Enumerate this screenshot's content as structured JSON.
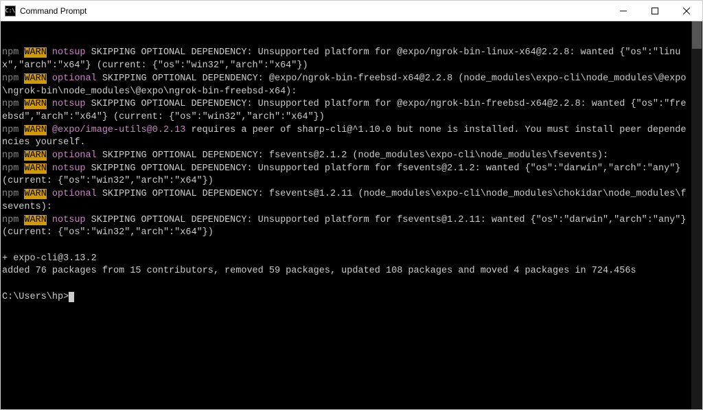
{
  "window": {
    "title": "Command Prompt",
    "icon_label": "C:\\"
  },
  "terminal": {
    "lines": [
      {
        "segments": [
          [
            "npm",
            "npm "
          ],
          [
            "warn",
            "WARN"
          ],
          [
            "plain",
            " "
          ],
          [
            "notsup",
            "notsup"
          ],
          [
            "plain",
            " SKIPPING OPTIONAL DEPENDENCY: Unsupported platform for @expo/ngrok-bin-linux-x64@2.2.8: wanted {\"os\":\"linux\",\"arch\":\"x64\"} (current: {\"os\":\"win32\",\"arch\":\"x64\"})"
          ]
        ]
      },
      {
        "segments": [
          [
            "npm",
            "npm "
          ],
          [
            "warn",
            "WARN"
          ],
          [
            "plain",
            " "
          ],
          [
            "optional",
            "optional"
          ],
          [
            "plain",
            " SKIPPING OPTIONAL DEPENDENCY: @expo/ngrok-bin-freebsd-x64@2.2.8 (node_modules\\expo-cli\\node_modules\\@expo\\ngrok-bin\\node_modules\\@expo\\ngrok-bin-freebsd-x64):"
          ]
        ]
      },
      {
        "segments": [
          [
            "npm",
            "npm "
          ],
          [
            "warn",
            "WARN"
          ],
          [
            "plain",
            " "
          ],
          [
            "notsup",
            "notsup"
          ],
          [
            "plain",
            " SKIPPING OPTIONAL DEPENDENCY: Unsupported platform for @expo/ngrok-bin-freebsd-x64@2.2.8: wanted {\"os\":\"freebsd\",\"arch\":\"x64\"} (current: {\"os\":\"win32\",\"arch\":\"x64\"})"
          ]
        ]
      },
      {
        "segments": [
          [
            "npm",
            "npm "
          ],
          [
            "warn",
            "WARN"
          ],
          [
            "plain",
            " "
          ],
          [
            "pkg",
            "@expo/image-utils@0.2.13"
          ],
          [
            "plain",
            " requires a peer of sharp-cli@^1.10.0 but none is installed. You must install peer dependencies yourself."
          ]
        ]
      },
      {
        "segments": [
          [
            "npm",
            "npm "
          ],
          [
            "warn",
            "WARN"
          ],
          [
            "plain",
            " "
          ],
          [
            "optional",
            "optional"
          ],
          [
            "plain",
            " SKIPPING OPTIONAL DEPENDENCY: fsevents@2.1.2 (node_modules\\expo-cli\\node_modules\\fsevents):"
          ]
        ]
      },
      {
        "segments": [
          [
            "npm",
            "npm "
          ],
          [
            "warn",
            "WARN"
          ],
          [
            "plain",
            " "
          ],
          [
            "notsup",
            "notsup"
          ],
          [
            "plain",
            " SKIPPING OPTIONAL DEPENDENCY: Unsupported platform for fsevents@2.1.2: wanted {\"os\":\"darwin\",\"arch\":\"any\"} (current: {\"os\":\"win32\",\"arch\":\"x64\"})"
          ]
        ]
      },
      {
        "segments": [
          [
            "npm",
            "npm "
          ],
          [
            "warn",
            "WARN"
          ],
          [
            "plain",
            " "
          ],
          [
            "optional",
            "optional"
          ],
          [
            "plain",
            " SKIPPING OPTIONAL DEPENDENCY: fsevents@1.2.11 (node_modules\\expo-cli\\node_modules\\chokidar\\node_modules\\fsevents):"
          ]
        ]
      },
      {
        "segments": [
          [
            "npm",
            "npm "
          ],
          [
            "warn",
            "WARN"
          ],
          [
            "plain",
            " "
          ],
          [
            "notsup",
            "notsup"
          ],
          [
            "plain",
            " SKIPPING OPTIONAL DEPENDENCY: Unsupported platform for fsevents@1.2.11: wanted {\"os\":\"darwin\",\"arch\":\"any\"} (current: {\"os\":\"win32\",\"arch\":\"x64\"})"
          ]
        ]
      },
      {
        "segments": [
          [
            "plain",
            ""
          ]
        ]
      },
      {
        "segments": [
          [
            "plain",
            "+ expo-cli@3.13.2"
          ]
        ]
      },
      {
        "segments": [
          [
            "plain",
            "added 76 packages from 15 contributors, removed 59 packages, updated 108 packages and moved 4 packages in 724.456s"
          ]
        ]
      },
      {
        "segments": [
          [
            "plain",
            ""
          ]
        ]
      }
    ],
    "prompt": "C:\\Users\\hp>"
  }
}
